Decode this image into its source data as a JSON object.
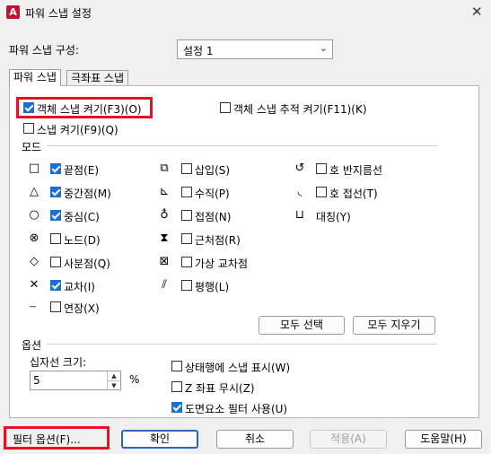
{
  "window": {
    "title": "파워 스냅 설정",
    "app_icon": "A",
    "close_glyph": "✕"
  },
  "config": {
    "label": "파워 스냅 구성:",
    "value": "설정 1"
  },
  "tabs": [
    "파워 스냅",
    "극좌표 스냅"
  ],
  "snap": {
    "osnap_on": {
      "label": "객체 스냅 켜기(F3)(O)",
      "checked": true
    },
    "otrack_on": {
      "label": "객체 스냅 추적 켜기(F11)(K)",
      "checked": false
    },
    "snap_on": {
      "label": "스냅 켜기(F9)(Q)",
      "checked": false
    }
  },
  "modes_title": "모드",
  "modes": [
    {
      "glyph": "□",
      "label": "끝점(E)",
      "checked": true
    },
    {
      "glyph": "△",
      "label": "중간점(M)",
      "checked": true
    },
    {
      "glyph": "○",
      "label": "중심(C)",
      "checked": true
    },
    {
      "glyph": "⊗",
      "label": "노드(D)",
      "checked": false
    },
    {
      "glyph": "◇",
      "label": "사분점(Q)",
      "checked": false
    },
    {
      "glyph": "✕",
      "label": "교차(I)",
      "checked": true
    },
    {
      "glyph": "---",
      "label": "연장(X)",
      "checked": false
    },
    {
      "glyph": "⧉",
      "label": "삽입(S)",
      "checked": false
    },
    {
      "glyph": "⊾",
      "label": "수직(P)",
      "checked": false
    },
    {
      "glyph": "♁",
      "label": "접점(N)",
      "checked": false
    },
    {
      "glyph": "⧗",
      "label": "근처점(R)",
      "checked": false
    },
    {
      "glyph": "⊠",
      "label": "가상 교차점",
      "checked": false
    },
    {
      "glyph": "⫽",
      "label": "평행(L)",
      "checked": false
    },
    {
      "glyph": "↺",
      "label": "호 반지름선",
      "checked": false
    },
    {
      "glyph": "◟",
      "label": "호 접선(T)",
      "checked": false
    },
    {
      "glyph": "⊔",
      "label": "대칭(Y)",
      "checked": false
    }
  ],
  "select_all": "모두 선택",
  "clear_all": "모두 지우기",
  "options": {
    "title": "옵션",
    "crosshair_label": "십자선 크기:",
    "crosshair_value": "5",
    "unit": "%",
    "show_status": {
      "label": "상태행에 스냅 표시(W)",
      "checked": false
    },
    "ignore_z": {
      "label": "Z 좌표 무시(Z)",
      "checked": false
    },
    "entity_filter": {
      "label": "도면요소 필터 사용(U)",
      "checked": true
    }
  },
  "buttons": {
    "filter": "필터 옵션(F)...",
    "ok": "확인",
    "cancel": "취소",
    "apply": "적용(A)",
    "help": "도움말(H)"
  }
}
